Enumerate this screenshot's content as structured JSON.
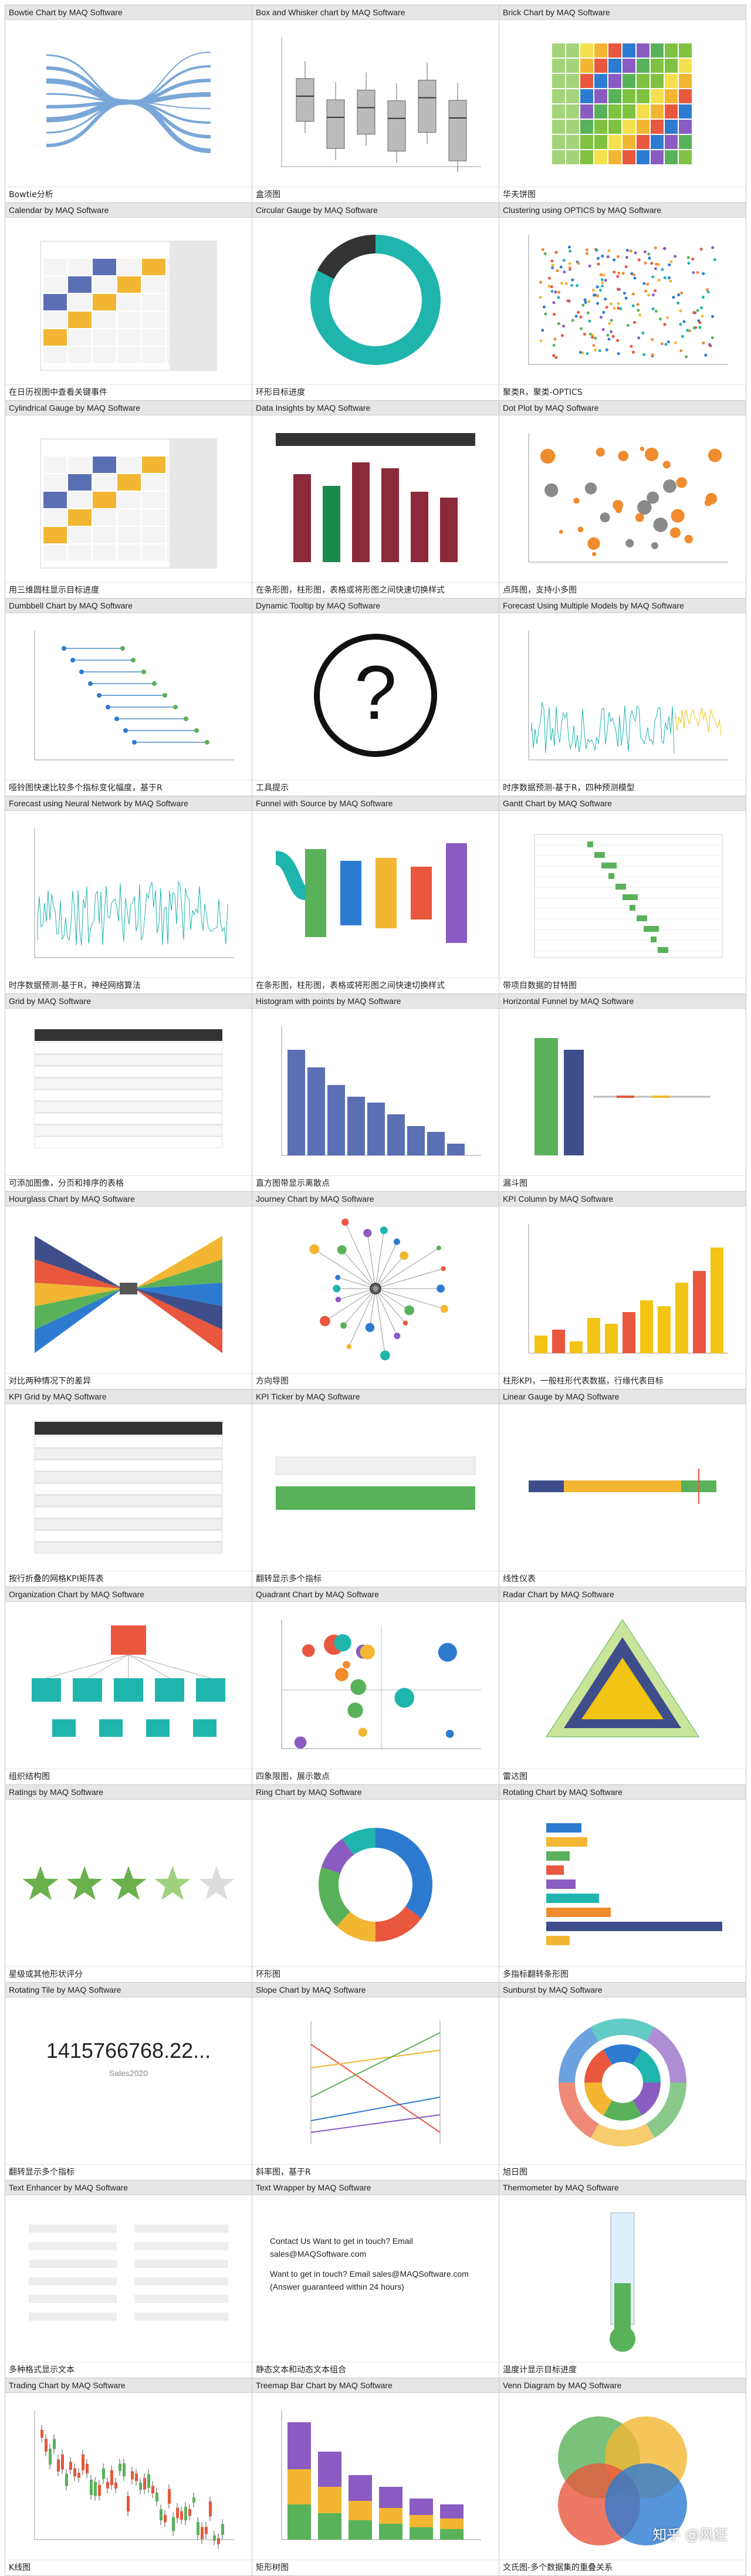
{
  "watermark": "知乎 @风狂",
  "cells": [
    {
      "title": "Bowtie Chart by MAQ Software",
      "caption": "Bowtie分析",
      "icon": "bowtie-chart-icon"
    },
    {
      "title": "Box and Whisker chart by MAQ Software",
      "caption": "盒须图",
      "icon": "box-whisker-chart-icon"
    },
    {
      "title": "Brick Chart by MAQ Software",
      "caption": "华夫饼图",
      "icon": "brick-chart-icon"
    },
    {
      "title": "Calendar by MAQ Software",
      "caption": "在日历视图中查看关键事件",
      "icon": "calendar-icon"
    },
    {
      "title": "Circular Gauge by MAQ Software",
      "caption": "环形目标进度",
      "icon": "circular-gauge-icon"
    },
    {
      "title": "Clustering using OPTICS by MAQ Software",
      "caption": "聚类R，聚类-OPTICS",
      "icon": "clustering-scatter-icon"
    },
    {
      "title": "Cylindrical Gauge by MAQ Software",
      "caption": "用三维圆柱显示目标进度",
      "icon": "calendar-icon"
    },
    {
      "title": "Data Insights by MAQ Software",
      "caption": "在条形图，柱形图，表格或将形图之间快速切换样式",
      "icon": "data-insights-icon"
    },
    {
      "title": "Dot Plot by MAQ Software",
      "caption": "点阵图，支持小多图",
      "icon": "dot-plot-icon"
    },
    {
      "title": "Dumbbell Chart by MAQ Software",
      "caption": "哑铃图快速比较多个指标变化幅度，基于R",
      "icon": "dumbbell-chart-icon"
    },
    {
      "title": "Dynamic Tooltip by MAQ Software",
      "caption": "工具提示",
      "icon": "question-mark-icon"
    },
    {
      "title": "Forecast Using Multiple Models by MAQ Software",
      "caption": "时序数据预测-基于R，四种预测模型",
      "icon": "forecast-chart-icon"
    },
    {
      "title": "Forecast using Neural Network by MAQ Software",
      "caption": "时序数据预测-基于R，神经网络算法",
      "icon": "neural-forecast-icon"
    },
    {
      "title": "Funnel with Source by MAQ Software",
      "caption": "在条形图，柱形图，表格或将形图之间快速切换样式",
      "icon": "funnel-source-icon"
    },
    {
      "title": "Gantt Chart by MAQ Software",
      "caption": "带项目数据的甘特图",
      "icon": "gantt-chart-icon"
    },
    {
      "title": "Grid by MAQ Software",
      "caption": "可添加图像，分页和排序的表格",
      "icon": "grid-table-icon"
    },
    {
      "title": "Histogram with points by MAQ Software",
      "caption": "直方图带显示离散点",
      "icon": "histogram-icon"
    },
    {
      "title": "Horizontal Funnel by MAQ Software",
      "caption": "漏斗图",
      "icon": "horizontal-funnel-icon"
    },
    {
      "title": "Hourglass Chart by MAQ Software",
      "caption": "对比两种情况下的差异",
      "icon": "hourglass-chart-icon"
    },
    {
      "title": "Journey Chart by MAQ Software",
      "caption": "方向导图",
      "icon": "journey-chart-icon"
    },
    {
      "title": "KPI Column by MAQ Software",
      "caption": "柱形KPI，一般柱形代表数据，行缘代表目标",
      "icon": "kpi-column-icon"
    },
    {
      "title": "KPI Grid by MAQ Software",
      "caption": "按行折叠的网格KPI矩阵表",
      "icon": "kpi-grid-icon"
    },
    {
      "title": "KPI Ticker by MAQ Software",
      "caption": "翻转显示多个指标",
      "icon": "kpi-ticker-icon"
    },
    {
      "title": "Linear Gauge by MAQ Software",
      "caption": "线性仪表",
      "icon": "linear-gauge-icon"
    },
    {
      "title": "Organization Chart by MAQ Software",
      "caption": "组织结构图",
      "icon": "org-chart-icon"
    },
    {
      "title": "Quadrant Chart by MAQ Software",
      "caption": "四象限图，展示散点",
      "icon": "quadrant-chart-icon"
    },
    {
      "title": "Radar Chart by MAQ Software",
      "caption": "雷达图",
      "icon": "radar-chart-icon"
    },
    {
      "title": "Ratings by MAQ Software",
      "caption": "星级或其他形状评分",
      "icon": "star-rating-icon"
    },
    {
      "title": "Ring Chart by MAQ Software",
      "caption": "环形图",
      "icon": "ring-chart-icon"
    },
    {
      "title": "Rotating Chart by MAQ Software",
      "caption": "多指标翻转条形图",
      "icon": "rotating-bar-icon"
    },
    {
      "title": "Rotating Tile by MAQ Software",
      "caption": "翻转显示多个指标",
      "icon": "rotating-tile-icon",
      "big": "1415766768.22...",
      "sub": "Sales2020"
    },
    {
      "title": "Slope Chart by MAQ Software",
      "caption": "斜率图，基于R",
      "icon": "slope-chart-icon"
    },
    {
      "title": "Sunburst by MAQ Software",
      "caption": "旭日图",
      "icon": "sunburst-chart-icon"
    },
    {
      "title": "Text Enhancer by MAQ Software",
      "caption": "多种格式显示文本",
      "icon": "text-enhancer-icon"
    },
    {
      "title": "Text Wrapper by MAQ Software",
      "caption": "静态文本和动态文本组合",
      "icon": "text-wrapper-icon",
      "lines": [
        "Contact Us  Want to get in touch? Email",
        "sales@MAQSoftware.com",
        "Want to get in touch? Email sales@MAQSoftware.com",
        "(Answer guaranteed within 24 hours)"
      ]
    },
    {
      "title": "Thermometer by MAQ Software",
      "caption": "温度计显示目标进度",
      "icon": "thermometer-icon"
    },
    {
      "title": "Trading Chart by MAQ Software",
      "caption": "K线图",
      "icon": "candlestick-chart-icon"
    },
    {
      "title": "Treemap Bar Chart by MAQ Software",
      "caption": "矩形树图",
      "icon": "treemap-bar-icon"
    },
    {
      "title": "Venn Diagram by MAQ Software",
      "caption": "文氏图-多个数据集的重叠关系",
      "icon": "venn-diagram-icon"
    }
  ]
}
